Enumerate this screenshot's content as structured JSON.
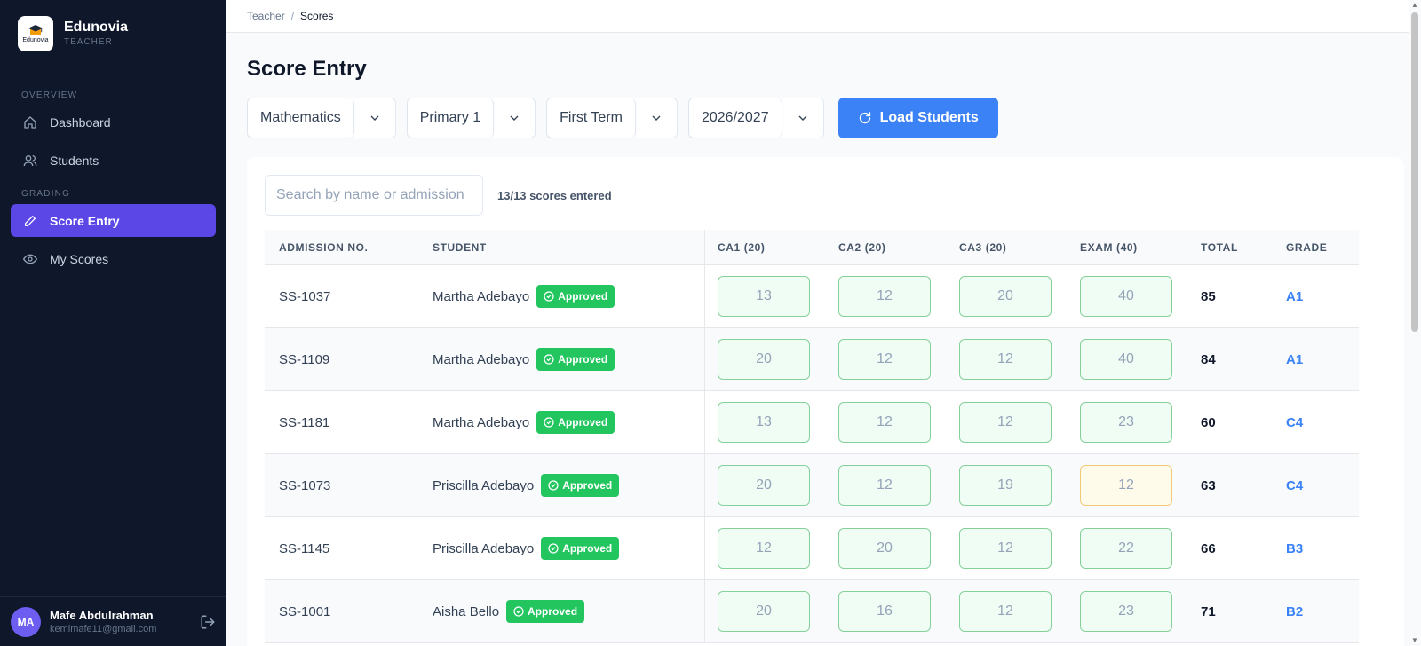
{
  "app": {
    "name": "Edunovia",
    "role": "TEACHER",
    "logo_text": "Edunovia"
  },
  "sidebar": {
    "sections": [
      {
        "title": "OVERVIEW",
        "items": [
          {
            "label": "Dashboard",
            "icon": "home-icon"
          },
          {
            "label": "Students",
            "icon": "users-icon"
          }
        ]
      },
      {
        "title": "GRADING",
        "items": [
          {
            "label": "Score Entry",
            "icon": "pencil-icon",
            "active": true
          },
          {
            "label": "My Scores",
            "icon": "eye-icon"
          }
        ]
      }
    ]
  },
  "user": {
    "initials": "MA",
    "name": "Mafe Abdulrahman",
    "email": "kemimafe11@gmail.com"
  },
  "breadcrumb": {
    "parent": "Teacher",
    "separator": "/",
    "current": "Scores"
  },
  "page": {
    "title": "Score Entry"
  },
  "filters": {
    "subject": "Mathematics",
    "class": "Primary 1",
    "term": "First Term",
    "session": "2026/2027",
    "load_label": "Load Students"
  },
  "search": {
    "placeholder": "Search by name or admission"
  },
  "summary": {
    "count": "13/13 scores entered"
  },
  "table": {
    "headers": {
      "admission": "ADMISSION NO.",
      "student": "STUDENT",
      "ca1": "CA1 (20)",
      "ca2": "CA2 (20)",
      "ca3": "CA3 (20)",
      "exam": "EXAM (40)",
      "total": "TOTAL",
      "grade": "GRADE"
    },
    "status_label": "Approved",
    "rows": [
      {
        "adm": "SS-1037",
        "name": "Martha Adebayo",
        "ca1": "13",
        "ca2": "12",
        "ca3": "20",
        "exam": "40",
        "total": "85",
        "grade": "A1"
      },
      {
        "adm": "SS-1109",
        "name": "Martha Adebayo",
        "ca1": "20",
        "ca2": "12",
        "ca3": "12",
        "exam": "40",
        "total": "84",
        "grade": "A1"
      },
      {
        "adm": "SS-1181",
        "name": "Martha Adebayo",
        "ca1": "13",
        "ca2": "12",
        "ca3": "12",
        "exam": "23",
        "total": "60",
        "grade": "C4"
      },
      {
        "adm": "SS-1073",
        "name": "Priscilla Adebayo",
        "ca1": "20",
        "ca2": "12",
        "ca3": "19",
        "exam": "12",
        "total": "63",
        "grade": "C4"
      },
      {
        "adm": "SS-1145",
        "name": "Priscilla Adebayo",
        "ca1": "12",
        "ca2": "20",
        "ca3": "12",
        "exam": "22",
        "total": "66",
        "grade": "B3"
      },
      {
        "adm": "SS-1001",
        "name": "Aisha Bello",
        "ca1": "20",
        "ca2": "16",
        "ca3": "12",
        "exam": "23",
        "total": "71",
        "grade": "B2"
      }
    ]
  },
  "colors": {
    "sidebar_bg": "#0f172a",
    "active_nav": "#5b46e6",
    "primary": "#3b82f6",
    "approved": "#22c55e",
    "grade_text": "#3b82f6"
  }
}
